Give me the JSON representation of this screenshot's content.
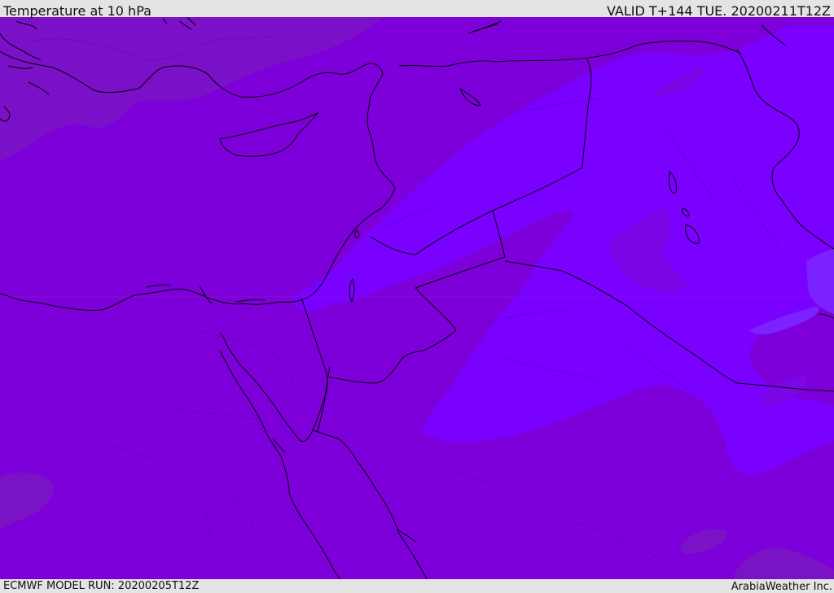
{
  "header": {
    "title": "Temperature at 10 hPa",
    "valid": "VALID T+144 TUE. 20200211T12Z"
  },
  "footer": {
    "model_run": "ECMWF MODEL RUN: 20200205T12Z",
    "credit": "ArabiaWeather Inc."
  },
  "colors": {
    "base_fill": "#7d00da",
    "warm_band": "#7a00ff",
    "cold_patch": "#7a10c8",
    "coast_line": "#000000",
    "header_bg": "#e4e4e4"
  }
}
